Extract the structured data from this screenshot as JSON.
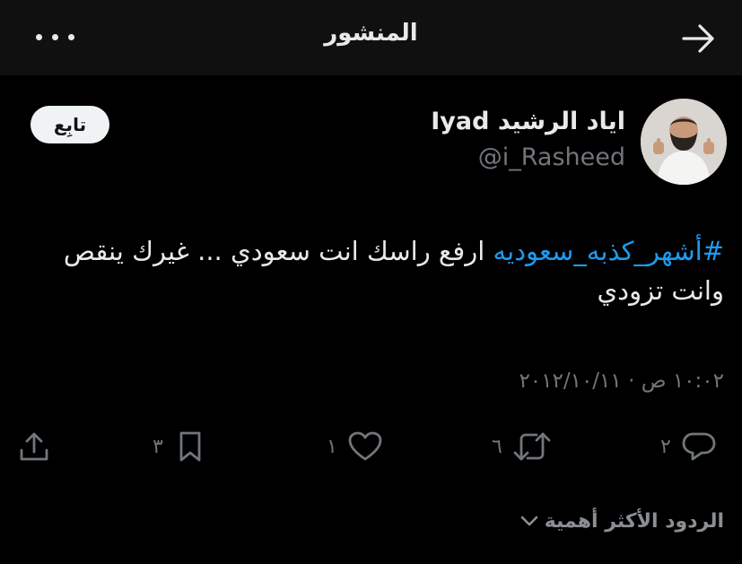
{
  "header": {
    "title": "المنشور",
    "more_icon": "more-horizontal-icon",
    "back_icon": "arrow-right-icon"
  },
  "author": {
    "display_name": "اياد الرشيد Iyad",
    "handle": "@i_Rasheed",
    "follow_label": "تابِع"
  },
  "tweet": {
    "hashtag": "#أشهر_كذبه_سعوديه",
    "text": "ارفع راسك انت سعودي ... غيرك ينقص وانت تزودي",
    "timestamp": "١٠:٠٢ ص · ٢٠١٢/١٠/١١"
  },
  "actions": {
    "reply_count": "٢",
    "retweet_count": "٦",
    "like_count": "١",
    "bookmark_count": "٣"
  },
  "replies": {
    "sort_label": "الردود الأكثر أهمية"
  },
  "colors": {
    "background": "#000000",
    "header_bg": "#101010",
    "link": "#1d9bf0",
    "secondary_text": "#71767b",
    "primary_text": "#e7e9ea"
  }
}
